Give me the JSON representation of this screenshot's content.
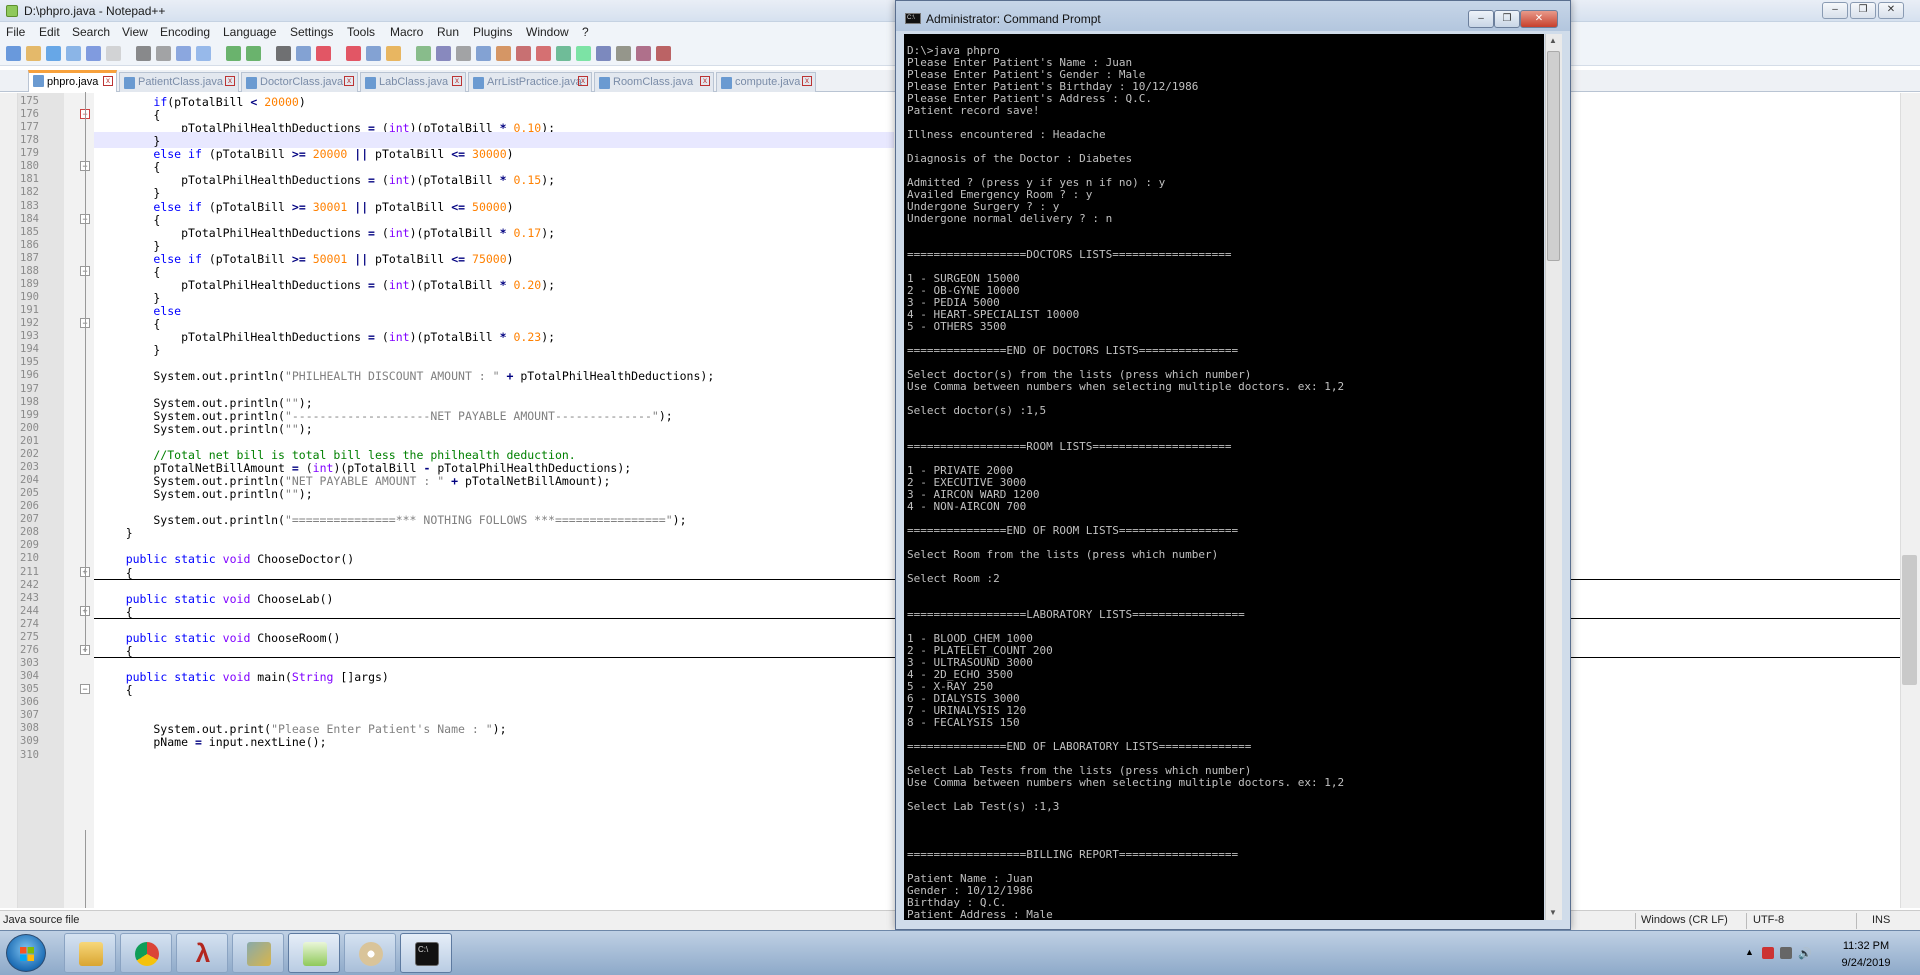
{
  "notepad": {
    "title": "D:\\phpro.java - Notepad++",
    "menu": [
      "File",
      "Edit",
      "Search",
      "View",
      "Encoding",
      "Language",
      "Settings",
      "Tools",
      "Macro",
      "Run",
      "Plugins",
      "Window",
      "?"
    ],
    "tabs": [
      "phpro.java",
      "PatientClass.java",
      "DoctorClass.java",
      "LabClass.java",
      "ArrListPractice.java",
      "RoomClass.java",
      "compute.java"
    ],
    "status": {
      "file_type": "Java source file",
      "eol": "Windows (CR LF)",
      "encoding": "UTF-8",
      "mode": "INS"
    }
  },
  "code_lines": [
    {
      "n": "175",
      "t": "        if(pTotalBill < 20000)"
    },
    {
      "n": "176",
      "t": "        {"
    },
    {
      "n": "177",
      "t": "            pTotalPhilHealthDeductions = (int)(pTotalBill * 0.10);"
    },
    {
      "n": "178",
      "t": "        }"
    },
    {
      "n": "179",
      "t": "        else if (pTotalBill >= 20000 || pTotalBill <= 30000)"
    },
    {
      "n": "180",
      "t": "        {"
    },
    {
      "n": "181",
      "t": "            pTotalPhilHealthDeductions = (int)(pTotalBill * 0.15);"
    },
    {
      "n": "182",
      "t": "        }"
    },
    {
      "n": "183",
      "t": "        else if (pTotalBill >= 30001 || pTotalBill <= 50000)"
    },
    {
      "n": "184",
      "t": "        {"
    },
    {
      "n": "185",
      "t": "            pTotalPhilHealthDeductions = (int)(pTotalBill * 0.17);"
    },
    {
      "n": "186",
      "t": "        }"
    },
    {
      "n": "187",
      "t": "        else if (pTotalBill >= 50001 || pTotalBill <= 75000)"
    },
    {
      "n": "188",
      "t": "        {"
    },
    {
      "n": "189",
      "t": "            pTotalPhilHealthDeductions = (int)(pTotalBill * 0.20);"
    },
    {
      "n": "190",
      "t": "        }"
    },
    {
      "n": "191",
      "t": "        else"
    },
    {
      "n": "192",
      "t": "        {"
    },
    {
      "n": "193",
      "t": "            pTotalPhilHealthDeductions = (int)(pTotalBill * 0.23);"
    },
    {
      "n": "194",
      "t": "        }"
    },
    {
      "n": "195",
      "t": ""
    },
    {
      "n": "196",
      "t": "        System.out.println(\"PHILHEALTH DISCOUNT AMOUNT : \" + pTotalPhilHealthDeductions);"
    },
    {
      "n": "197",
      "t": ""
    },
    {
      "n": "198",
      "t": "        System.out.println(\"\");"
    },
    {
      "n": "199",
      "t": "        System.out.println(\"--------------------NET PAYABLE AMOUNT--------------\");"
    },
    {
      "n": "200",
      "t": "        System.out.println(\"\");"
    },
    {
      "n": "201",
      "t": ""
    },
    {
      "n": "202",
      "t": "        //Total net bill is total bill less the philhealth deduction."
    },
    {
      "n": "203",
      "t": "        pTotalNetBillAmount = (int)(pTotalBill - pTotalPhilHealthDeductions);"
    },
    {
      "n": "204",
      "t": "        System.out.println(\"NET PAYABLE AMOUNT : \" + pTotalNetBillAmount);"
    },
    {
      "n": "205",
      "t": "        System.out.println(\"\");"
    },
    {
      "n": "206",
      "t": ""
    },
    {
      "n": "207",
      "t": "        System.out.println(\"===============*** NOTHING FOLLOWS ***================\");"
    },
    {
      "n": "208",
      "t": "    }"
    },
    {
      "n": "209",
      "t": ""
    },
    {
      "n": "210",
      "t": "    public static void ChooseDoctor()"
    },
    {
      "n": "211",
      "t": "    {"
    },
    {
      "n": "242",
      "t": ""
    },
    {
      "n": "243",
      "t": "    public static void ChooseLab()"
    },
    {
      "n": "244",
      "t": "    {"
    },
    {
      "n": "274",
      "t": ""
    },
    {
      "n": "275",
      "t": "    public static void ChooseRoom()"
    },
    {
      "n": "276",
      "t": "    {"
    },
    {
      "n": "303",
      "t": ""
    },
    {
      "n": "304",
      "t": "    public static void main(String []args)"
    },
    {
      "n": "305",
      "t": "    {"
    },
    {
      "n": "306",
      "t": ""
    },
    {
      "n": "307",
      "t": ""
    },
    {
      "n": "308",
      "t": "        System.out.print(\"Please Enter Patient's Name : \");"
    },
    {
      "n": "309",
      "t": "        pName = input.nextLine();"
    },
    {
      "n": "310",
      "t": ""
    }
  ],
  "cmd": {
    "title": "Administrator: Command Prompt",
    "lines": [
      "D:\\>java phpro",
      "Please Enter Patient's Name : Juan",
      "Please Enter Patient's Gender : Male",
      "Please Enter Patient's Birthday : 10/12/1986",
      "Please Enter Patient's Address : Q.C.",
      "Patient record save!",
      "",
      "Illness encountered : Headache",
      "",
      "Diagnosis of the Doctor : Diabetes",
      "",
      "Admitted ? (press y if yes n if no) : y",
      "Availed Emergency Room ? : y",
      "Undergone Surgery ? : y",
      "Undergone normal delivery ? : n",
      "",
      "",
      "==================DOCTORS LISTS==================",
      "",
      "1 - SURGEON 15000",
      "2 - OB-GYNE 10000",
      "3 - PEDIA 5000",
      "4 - HEART-SPECIALIST 10000",
      "5 - OTHERS 3500",
      "",
      "===============END OF DOCTORS LISTS===============",
      "",
      "Select doctor(s) from the lists (press which number)",
      "Use Comma between numbers when selecting multiple doctors. ex: 1,2",
      "",
      "Select doctor(s) :1,5",
      "",
      "",
      "==================ROOM LISTS=====================",
      "",
      "1 - PRIVATE 2000",
      "2 - EXECUTIVE 3000",
      "3 - AIRCON WARD 1200",
      "4 - NON-AIRCON 700",
      "",
      "===============END OF ROOM LISTS==================",
      "",
      "Select Room from the lists (press which number)",
      "",
      "Select Room :2",
      "",
      "",
      "==================LABORATORY LISTS=================",
      "",
      "1 - BLOOD_CHEM 1000",
      "2 - PLATELET_COUNT 200",
      "3 - ULTRASOUND 3000",
      "4 - 2D_ECHO 3500",
      "5 - X-RAY 250",
      "6 - DIALYSIS 3000",
      "7 - URINALYSIS 120",
      "8 - FECALYSIS 150",
      "",
      "===============END OF LABORATORY LISTS==============",
      "",
      "Select Lab Tests from the lists (press which number)",
      "Use Comma between numbers when selecting multiple doctors. ex: 1,2",
      "",
      "Select Lab Test(s) :1,3",
      "",
      "",
      "",
      "==================BILLING REPORT==================",
      "",
      "Patient Name : Juan",
      "Gender : 10/12/1986",
      "Birthday : Q.C.",
      "Patient Address : Male"
    ]
  },
  "taskbar": {
    "time": "11:32 PM",
    "date": "9/24/2019"
  }
}
